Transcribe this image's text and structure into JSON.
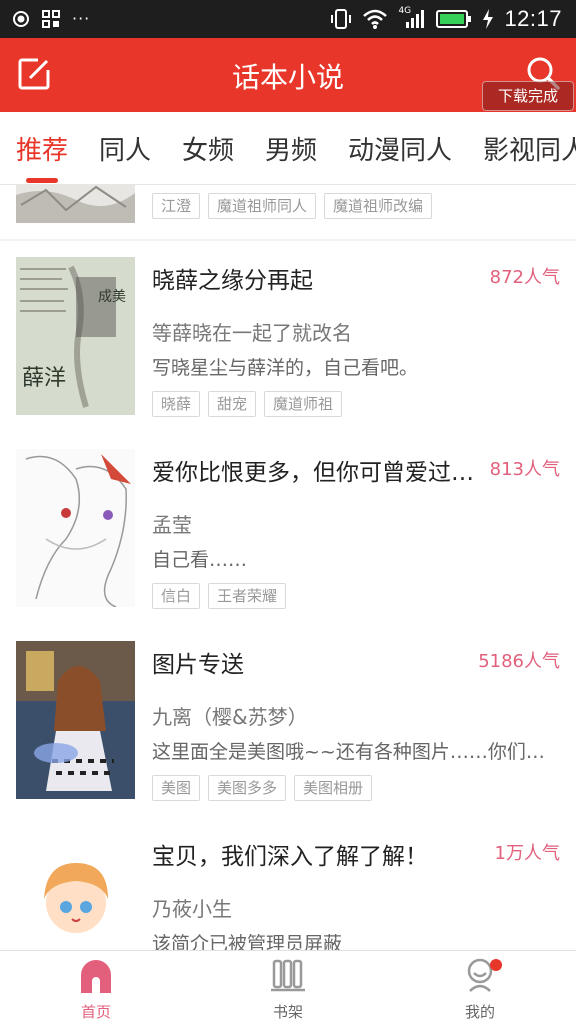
{
  "status_bar": {
    "time": "12:17",
    "network_label": "4G",
    "left_icons": [
      "record-icon",
      "grid-icon",
      "more-dots-icon"
    ],
    "right_icons": [
      "vibrate-icon",
      "wifi-icon",
      "signal-icon",
      "battery-icon",
      "charging-icon"
    ]
  },
  "header": {
    "title": "话本小说",
    "toast": "下载完成",
    "icons": [
      "edit-icon",
      "search-icon"
    ],
    "background": "#e8372a"
  },
  "tabs": [
    {
      "label": "推荐",
      "active": true
    },
    {
      "label": "同人"
    },
    {
      "label": "女频"
    },
    {
      "label": "男频"
    },
    {
      "label": "动漫同人"
    },
    {
      "label": "影视同人"
    }
  ],
  "books": [
    {
      "tags": [
        "江澄",
        "魔道祖师同人",
        "魔道祖师改编"
      ]
    },
    {
      "title": "晓薛之缘分再起",
      "popularity": "872人气",
      "author": "等薛晓在一起了就改名",
      "desc": "写晓星尘与薛洋的，自己看吧。",
      "tags": [
        "晓薛",
        "甜宠",
        "魔道师祖"
      ],
      "cover_text": [
        "薛洋",
        "成美",
        "成自己之美"
      ]
    },
    {
      "title": "爱你比恨更多，但你可曾爱过我？",
      "popularity": "813人气",
      "author": "孟莹",
      "desc": "自己看……",
      "tags": [
        "信白",
        "王者荣耀"
      ]
    },
    {
      "title": "图片专送",
      "popularity": "5186人气",
      "author": "九离（樱&苏梦）",
      "desc": "这里面全是美图哦~~还有各种图片……你们喜欢吗",
      "tags": [
        "美图",
        "美图多多",
        "美图相册"
      ]
    },
    {
      "title": "宝贝，我们深入了解了解！",
      "popularity": "1万人气",
      "author": "乃莜小生",
      "desc": "该简介已被管理员屏蔽",
      "tags": []
    }
  ],
  "bottom_nav": [
    {
      "label": "首页",
      "icon": "home-icon",
      "active": true
    },
    {
      "label": "书架",
      "icon": "bookshelf-icon"
    },
    {
      "label": "我的",
      "icon": "profile-icon",
      "badge": true
    }
  ],
  "colors": {
    "accent": "#e8372a",
    "popularity": "#e2607c"
  }
}
